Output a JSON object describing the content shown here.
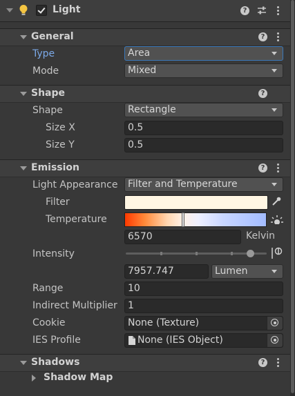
{
  "component": {
    "title": "Light",
    "enabled": true
  },
  "general": {
    "title": "General",
    "type": {
      "label": "Type",
      "value": "Area"
    },
    "mode": {
      "label": "Mode",
      "value": "Mixed"
    }
  },
  "shape": {
    "title": "Shape",
    "shape": {
      "label": "Shape",
      "value": "Rectangle"
    },
    "size_x": {
      "label": "Size X",
      "value": "0.5"
    },
    "size_y": {
      "label": "Size Y",
      "value": "0.5"
    }
  },
  "emission": {
    "title": "Emission",
    "appearance": {
      "label": "Light Appearance",
      "value": "Filter and Temperature"
    },
    "filter": {
      "label": "Filter",
      "color": "#fff6e3"
    },
    "temperature": {
      "label": "Temperature",
      "value": "6570",
      "unit": "Kelvin",
      "fraction": 0.41
    },
    "intensity": {
      "label": "Intensity",
      "value": "7957.747",
      "unit": "Lumen",
      "fraction": 0.88
    },
    "range": {
      "label": "Range",
      "value": "10"
    },
    "indirect": {
      "label": "Indirect Multiplier",
      "value": "1"
    },
    "cookie": {
      "label": "Cookie",
      "value": "None (Texture)"
    },
    "ies": {
      "label": "IES Profile",
      "value": "None (IES Object)"
    }
  },
  "shadows": {
    "title": "Shadows",
    "shadow_map": {
      "label": "Shadow Map"
    }
  },
  "help_glyph": "?",
  "icons": [
    "lightbulb-icon",
    "help-icon",
    "preset-icon",
    "kebab-menu-icon",
    "eyedropper-icon",
    "sun-icon",
    "object-picker-icon",
    "file-icon"
  ]
}
